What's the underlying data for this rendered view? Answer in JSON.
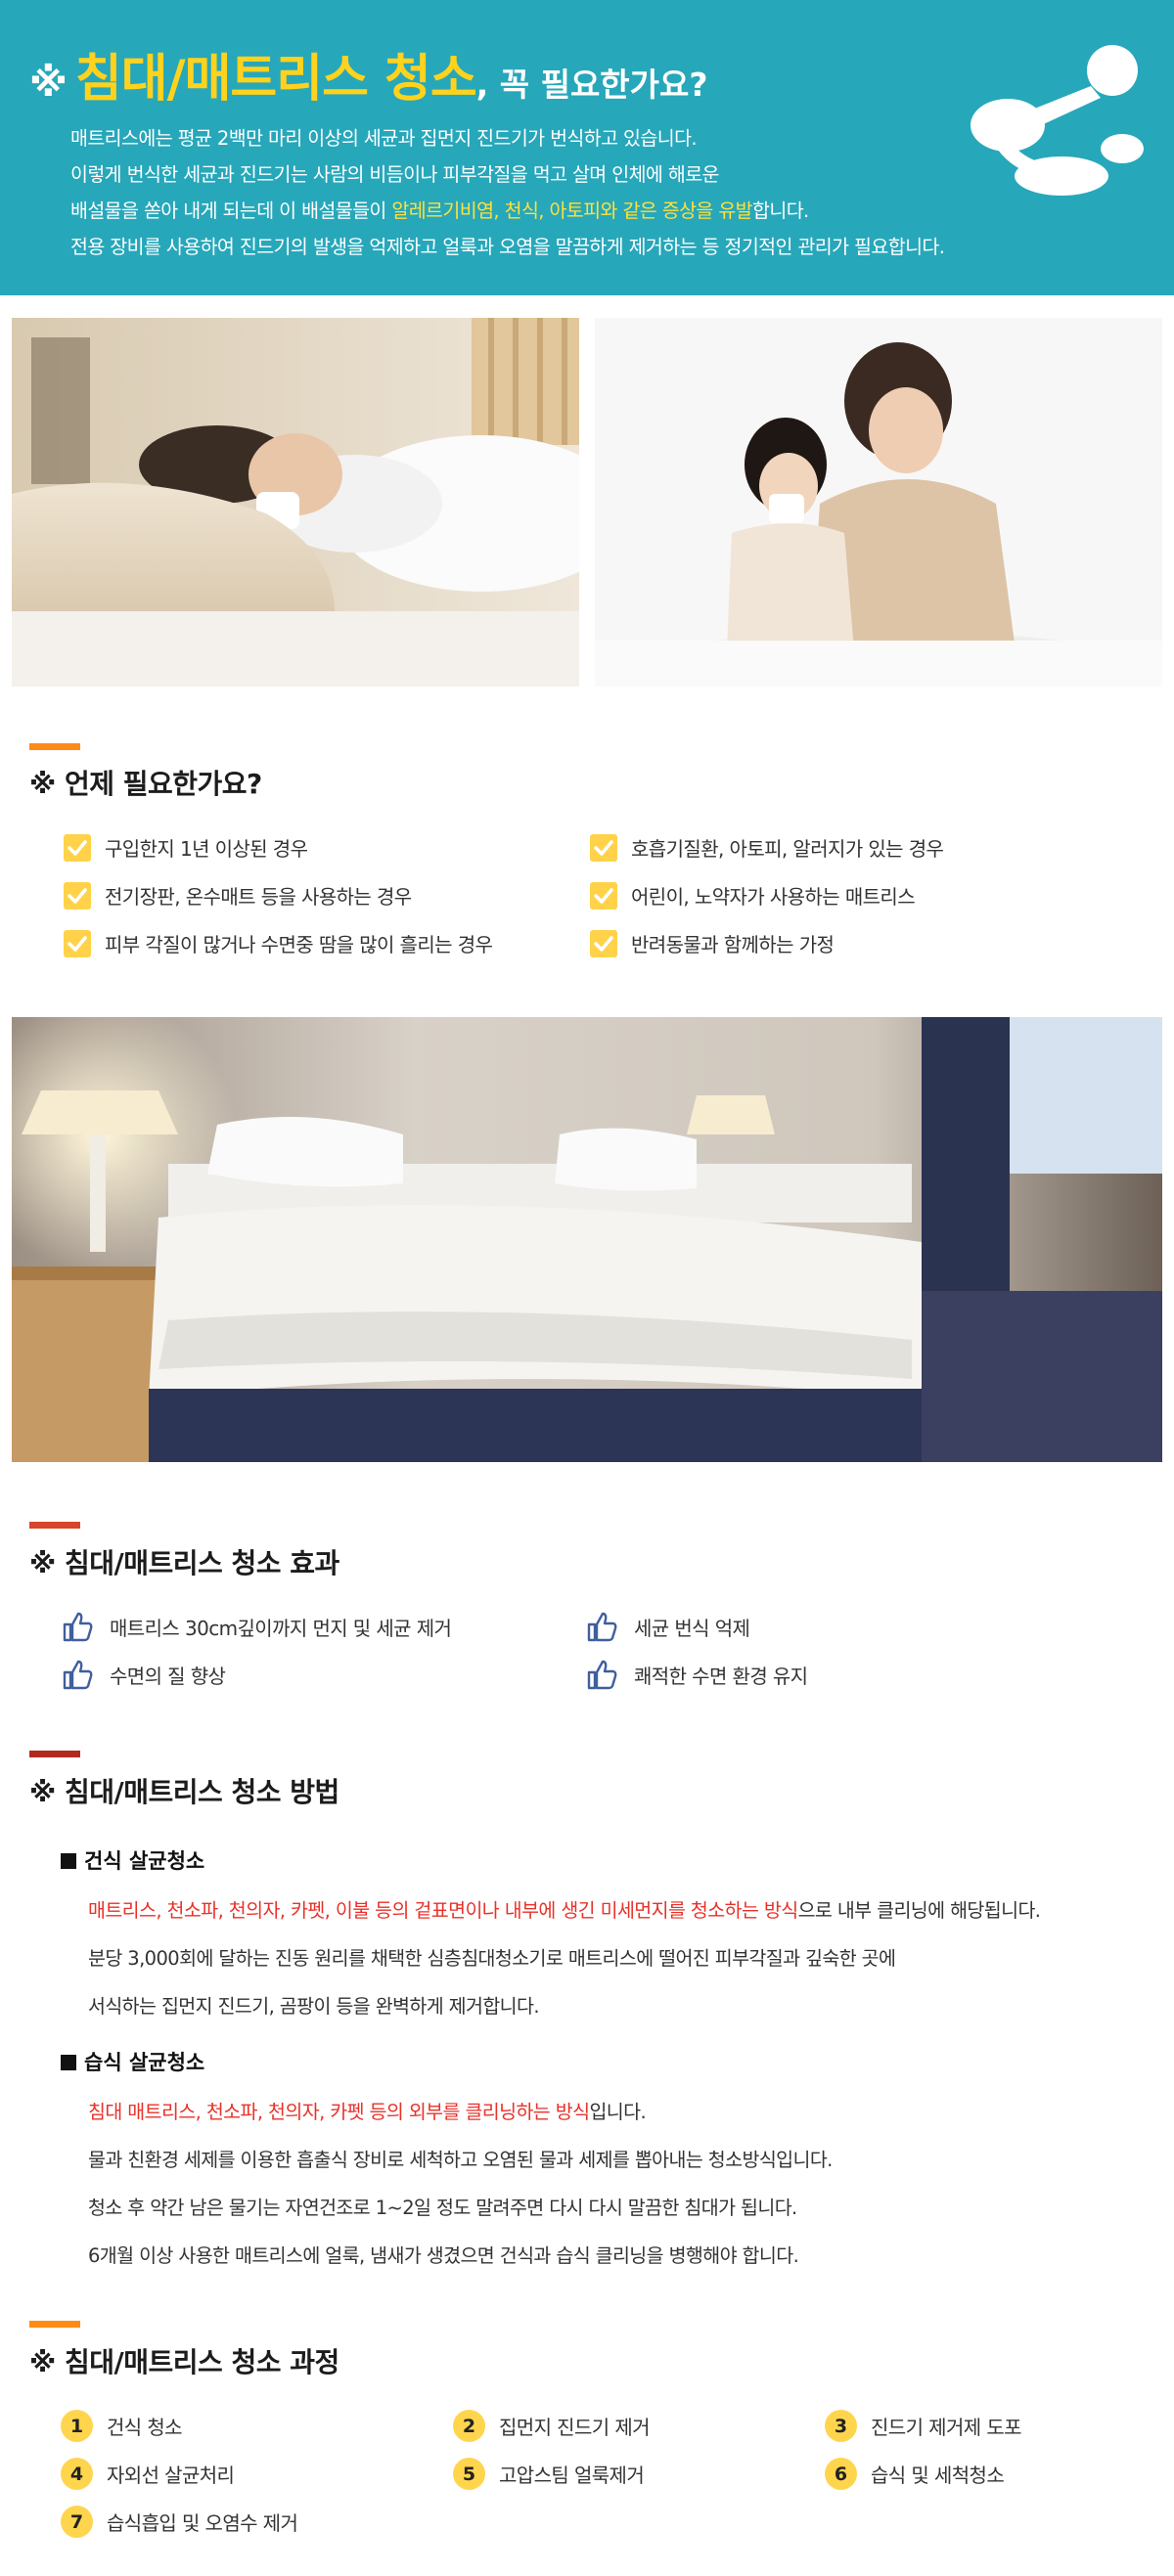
{
  "hero": {
    "title_mark": "※",
    "title_main": "침대/매트리스 청소",
    "title_rest": ", 꼭 필요한가요?",
    "line1": "매트리스에는 평균 2백만 마리 이상의 세균과 집먼지 진드기가 번식하고 있습니다.",
    "line2": "이렇게 번식한 세균과 진드기는 사람의 비듬이나 피부각질을 먹고 살며 인체에 해로운",
    "line3_pre": "배설물을 쏟아 내게 되는데 이 배설물들이 ",
    "line3_hl": "알레르기비염, 천식, 아토피와 같은 증상을 유발",
    "line3_post": "합니다.",
    "line4": "전용 장비를 사용하여 진드기의 발생을 억제하고 얼룩과 오염을 말끔하게 제거하는 등 정기적인 관리가 필요합니다."
  },
  "when": {
    "title": "※ 언제 필요한가요?",
    "left": [
      "구입한지 1년 이상된 경우",
      "전기장판, 온수매트 등을 사용하는 경우",
      "피부 각질이 많거나 수면중 땀을 많이 흘리는 경우"
    ],
    "right": [
      "호흡기질환, 아토피, 알러지가 있는 경우",
      "어린이, 노약자가 사용하는 매트리스",
      "반려동물과 함께하는 가정"
    ]
  },
  "effect": {
    "title": "※ 침대/매트리스 청소 효과",
    "left": [
      "매트리스 30cm깊이까지 먼지 및 세균 제거",
      "수면의 질 향상"
    ],
    "right": [
      "세균 번식 억제",
      "쾌적한 수면 환경 유지"
    ]
  },
  "method": {
    "title": "※ 침대/매트리스 청소 방법",
    "dry": {
      "heading": "건식 살균청소",
      "l1_red": "매트리스, 천소파, 천의자, 카펫, 이불 등의 겉표면이나 내부에 생긴 미세먼지를 청소하는 방식",
      "l1_rest": "으로 내부 클리닝에 해당됩니다.",
      "l2": "분당 3,000회에 달하는 진동 원리를 채택한 심층침대청소기로 매트리스에 떨어진 피부각질과 깊숙한 곳에",
      "l3": "서식하는 집먼지 진드기, 곰팡이 등을 완벽하게 제거합니다."
    },
    "wet": {
      "heading": "습식 살균청소",
      "l1_red": "침대 매트리스, 천소파, 천의자, 카펫 등의 외부를 클리닝하는 방식",
      "l1_rest": "입니다.",
      "l2": "물과 친환경 세제를 이용한 흡출식 장비로 세척하고 오염된 물과 세제를 뽑아내는 청소방식입니다.",
      "l3": "청소 후 약간 남은 물기는 자연건조로 1~2일 정도 말려주면 다시 다시 말끔한 침대가 됩니다.",
      "l4": "6개월 이상 사용한 매트리스에 얼룩, 냄새가 생겼으면 건식과 습식 클리닝을 병행해야 합니다."
    }
  },
  "process": {
    "title": "※ 침대/매트리스 청소 과정",
    "steps": [
      {
        "n": "1",
        "label": "건식 청소"
      },
      {
        "n": "2",
        "label": "집먼지 진드기 제거"
      },
      {
        "n": "3",
        "label": "진드기 제거제 도포"
      },
      {
        "n": "4",
        "label": "자외선 살균처리"
      },
      {
        "n": "5",
        "label": "고압스팀 얼룩제거"
      },
      {
        "n": "6",
        "label": "습식 및 세척청소"
      },
      {
        "n": "7",
        "label": "습식흡입 및 오염수 제거"
      }
    ]
  },
  "colors": {
    "hero_bg": "#27a7ba",
    "title_yellow": "#ffd21e",
    "highlight_yellow": "#ffe13b",
    "accent_orange": "#ff8a16",
    "accent_red": "#e8322a",
    "check_yellow": "#ffd24a",
    "thumb_blue": "#3f5f9e"
  }
}
